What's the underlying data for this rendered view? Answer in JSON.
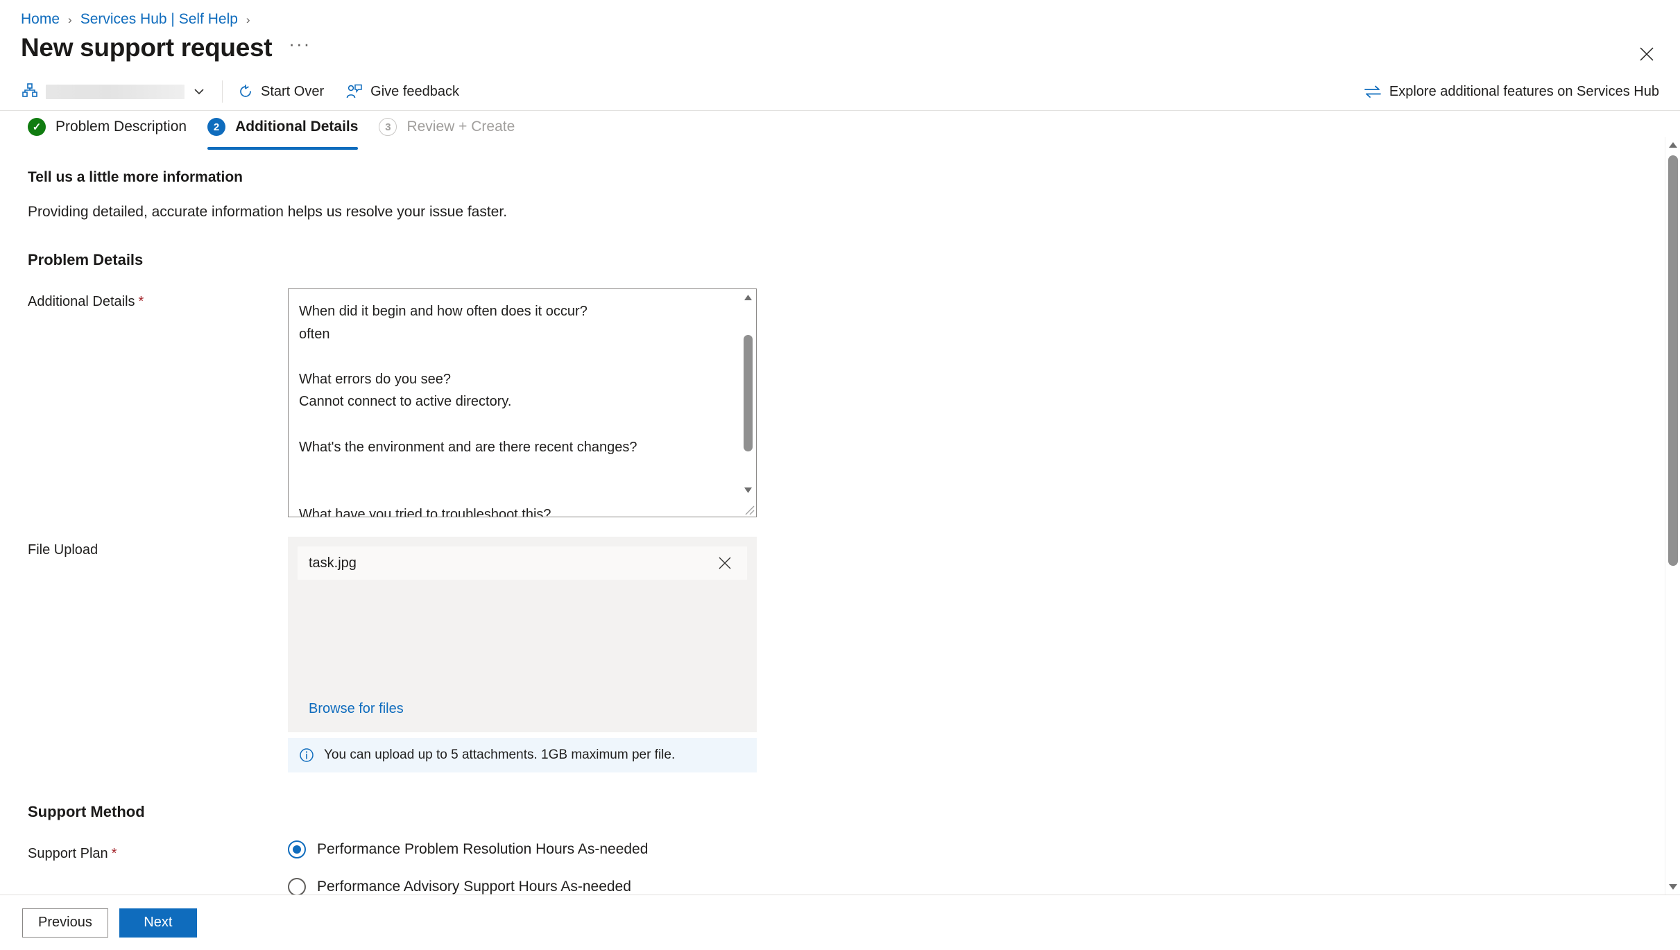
{
  "breadcrumb": {
    "items": [
      {
        "label": "Home"
      },
      {
        "label": "Services Hub | Self Help"
      }
    ],
    "separator": "›"
  },
  "header": {
    "title": "New support request",
    "ellipsis": "···",
    "close_icon": "close-icon"
  },
  "commandbar": {
    "subscription_value": "",
    "start_over": "Start Over",
    "give_feedback": "Give feedback",
    "explore_link": "Explore additional features on Services Hub"
  },
  "tabs": [
    {
      "label": "Problem Description",
      "badge": "✓",
      "state": "done"
    },
    {
      "label": "Additional Details",
      "badge": "2",
      "state": "active"
    },
    {
      "label": "Review + Create",
      "badge": "3",
      "state": "pending"
    }
  ],
  "main": {
    "intro_heading": "Tell us a little more information",
    "intro_text": "Providing detailed, accurate information helps us resolve your issue faster.",
    "problem_details_heading": "Problem Details",
    "additional_details_label": "Additional Details",
    "additional_details_value": "When did it begin and how often does it occur?\noften\n\nWhat errors do you see?\nCannot connect to active directory.\n\nWhat's the environment and are there recent changes?\n\n\nWhat have you tried to troubleshoot this?\nYes",
    "file_upload_label": "File Upload",
    "uploaded_file_name": "task.jpg",
    "browse_for_files": "Browse for files",
    "upload_info": "You can upload up to 5 attachments. 1GB maximum per file.",
    "support_method_heading": "Support Method",
    "support_plan_label": "Support Plan",
    "support_plan_options": [
      {
        "label": "Performance Problem Resolution Hours As-needed",
        "checked": true
      },
      {
        "label": "Performance Advisory Support Hours As-needed",
        "checked": false
      }
    ]
  },
  "footer": {
    "previous": "Previous",
    "next": "Next"
  },
  "colors": {
    "accent": "#0f6cbd",
    "success": "#107c10",
    "required": "#a4262c",
    "info_bg": "#eff6fc",
    "upload_bg": "#f3f2f1"
  }
}
